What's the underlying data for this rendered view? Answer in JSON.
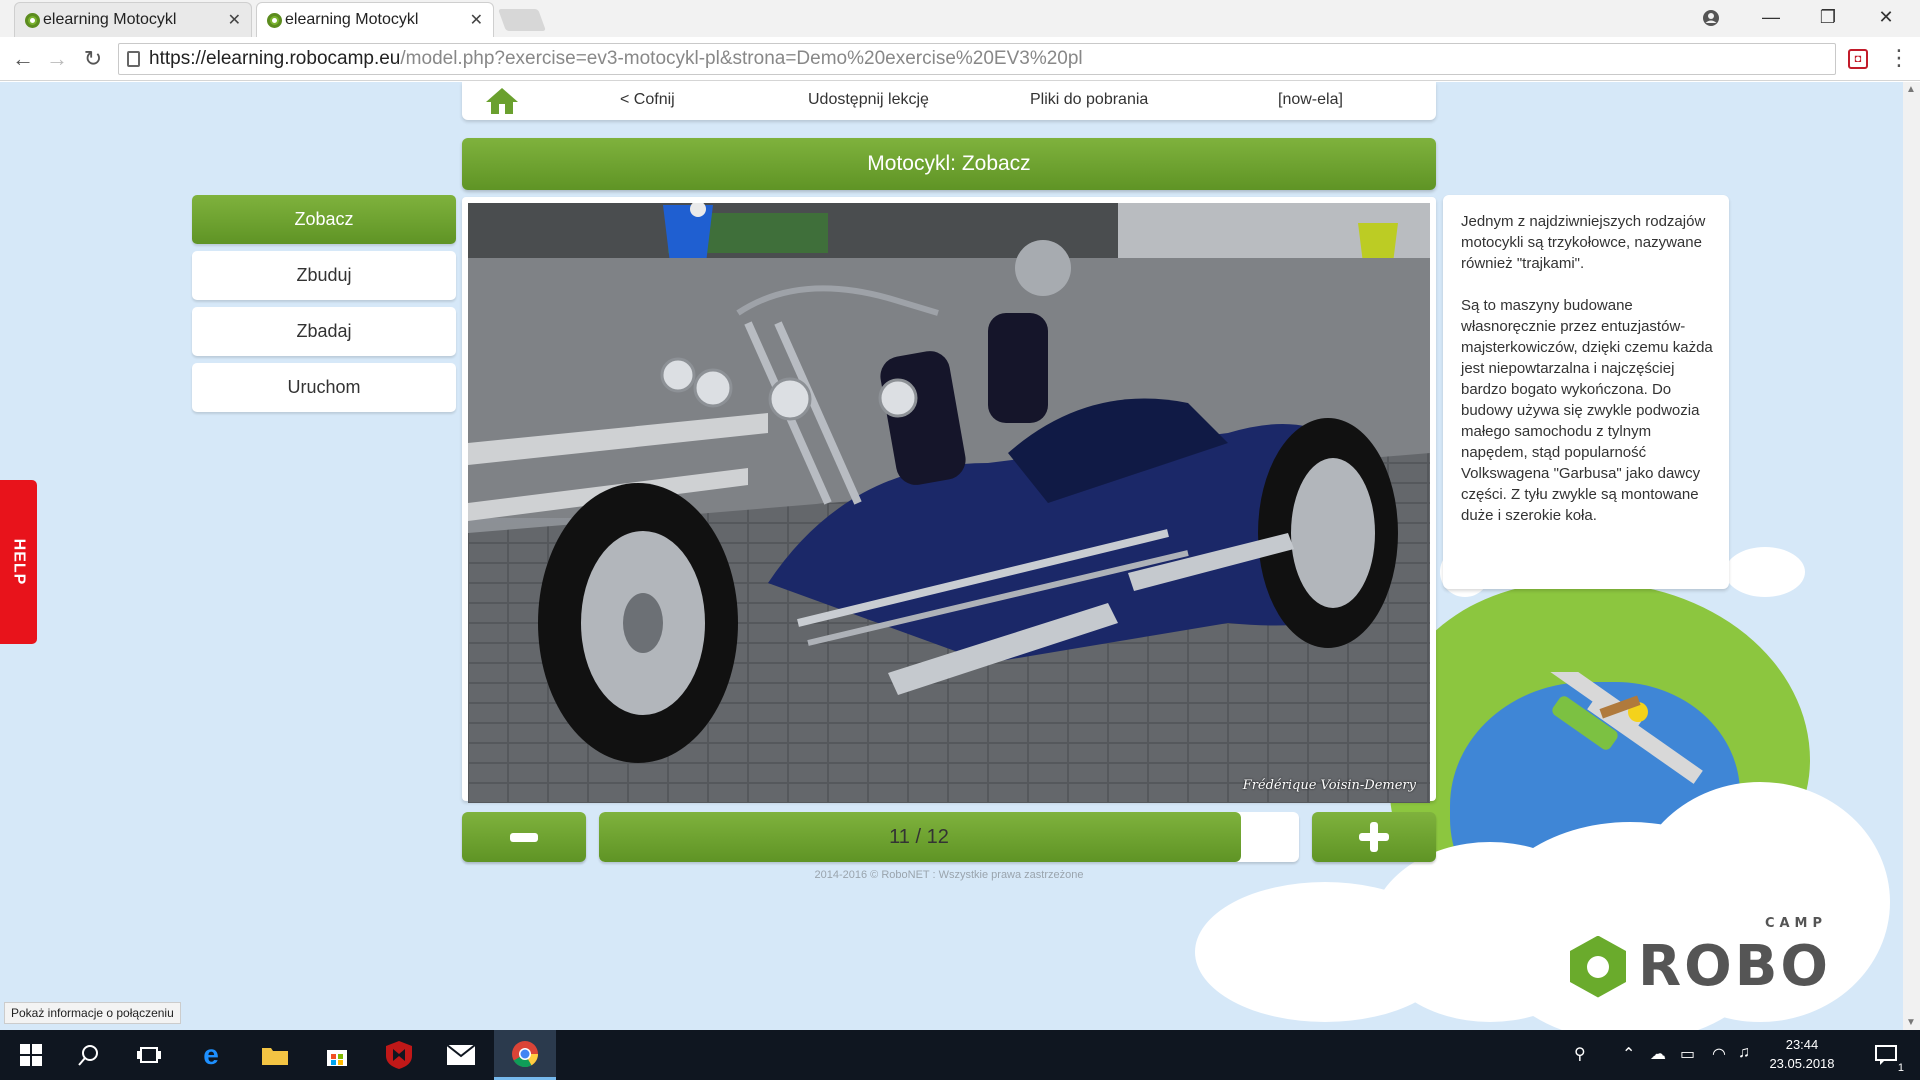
{
  "browser": {
    "tabs": [
      {
        "title": "elearning Motocykl",
        "active": false
      },
      {
        "title": "elearning Motocykl",
        "active": true
      }
    ],
    "url_host": "https://elearning.robocamp.eu",
    "url_path": "/model.php?exercise=ev3-motocykl-pl&strona=Demo%20exercise%20EV3%20pl",
    "window_controls": {
      "profile": "profile-icon",
      "minimize": "—",
      "maximize": "❐",
      "close": "✕"
    }
  },
  "page": {
    "topnav": {
      "home_icon": "home-icon",
      "back": "< Cofnij",
      "share": "Udostępnij lekcję",
      "downloads": "Pliki do pobrania",
      "user": "[now-ela]"
    },
    "title": "Motocykl: Zobacz",
    "side_menu": [
      {
        "label": "Zobacz",
        "active": true
      },
      {
        "label": "Zbuduj",
        "active": false
      },
      {
        "label": "Zbadaj",
        "active": false
      },
      {
        "label": "Uruchom",
        "active": false
      }
    ],
    "photo": {
      "credit": "Frédérique Voisin-Demery",
      "subject": "trike-motorcycle-photo"
    },
    "pager": {
      "label": "11 / 12",
      "current": 11,
      "total": 12
    },
    "footer": "2014-2016 © RoboNET : Wszystkie prawa zastrzeżone",
    "description": [
      "Jednym z najdziwniejszych rodzajów motocykli są trzykołowce, nazywane również \"trajkami\".",
      "Są to maszyny budowane własnoręcznie przez entuzjastów-majsterkowiczów, dzięki czemu każda jest niepowtarzalna i najczęściej bardzo bogato wykończona. Do budowy używa się zwykle podwozia małego samochodu z tylnym napędem, stąd popularność Volkswagena \"Garbusa\" jako dawcy części. Z tyłu zwykle są montowane duże i szerokie koła."
    ],
    "help_tab": "HELP",
    "logo": {
      "main": "ROBO",
      "sub": "CAMP"
    },
    "status_tooltip": "Pokaż informacje o połączeniu",
    "accent_color": "#6aa02e"
  },
  "taskbar": {
    "time": "23:44",
    "date": "23.05.2018",
    "notification_count": "1"
  }
}
